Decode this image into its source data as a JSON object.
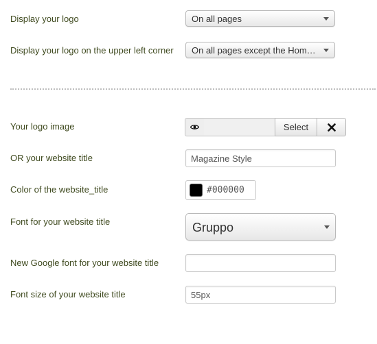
{
  "fields": {
    "display_logo": {
      "label": "Display your logo",
      "value": "On all pages"
    },
    "logo_upper_left": {
      "label": "Display your logo on the upper left corner",
      "value": "On all pages except the Hom…"
    },
    "logo_image": {
      "label": "Your logo image",
      "select_label": "Select",
      "preview_icon": "eye-icon",
      "clear_icon": "close-icon"
    },
    "website_title": {
      "label": "OR your website title",
      "value": "Magazine Style"
    },
    "title_color": {
      "label": "Color of the website_title",
      "value": "#000000",
      "swatch_color": "#000000"
    },
    "title_font": {
      "label": "Font for your website title",
      "value": "Gruppo"
    },
    "google_font": {
      "label": "New Google font for your website title",
      "value": ""
    },
    "title_font_size": {
      "label": "Font size of your website title",
      "value": "55px"
    }
  },
  "colors": {
    "label_text": "#3f4a1f",
    "divider": "#bdbdbd"
  }
}
